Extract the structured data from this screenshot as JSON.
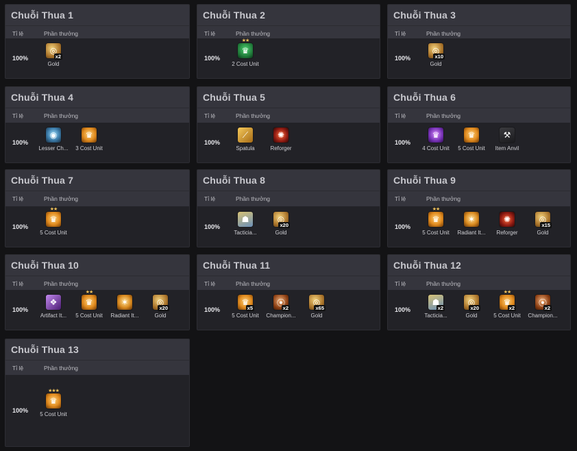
{
  "header": {
    "rate_label": "Tỉ lệ",
    "reward_label": "Phần thưởng"
  },
  "cards": [
    {
      "title": "Chuỗi Thua 1",
      "rate": "100%",
      "rewards": [
        {
          "label": "Gold",
          "icon": "gold-icon",
          "qty": "x2"
        }
      ]
    },
    {
      "title": "Chuỗi Thua 2",
      "rate": "100%",
      "rewards": [
        {
          "label": "2 Cost Unit",
          "icon": "unit-icon",
          "stars": "★★"
        }
      ]
    },
    {
      "title": "Chuỗi Thua 3",
      "rate": "100%",
      "rewards": [
        {
          "label": "Gold",
          "icon": "gold-icon",
          "qty": "x10"
        }
      ]
    },
    {
      "title": "Chuỗi Thua 4",
      "rate": "100%",
      "rewards": [
        {
          "label": "Lesser Ch...",
          "icon": "lesser-champion-orb-icon"
        },
        {
          "label": "3 Cost Unit",
          "icon": "unit-icon"
        }
      ]
    },
    {
      "title": "Chuỗi Thua 5",
      "rate": "100%",
      "rewards": [
        {
          "label": "Spatula",
          "icon": "spatula-icon"
        },
        {
          "label": "Reforger",
          "icon": "reforger-icon"
        }
      ]
    },
    {
      "title": "Chuỗi Thua 6",
      "rate": "100%",
      "rewards": [
        {
          "label": "4 Cost Unit",
          "icon": "unit-icon"
        },
        {
          "label": "5 Cost Unit",
          "icon": "unit-icon"
        },
        {
          "label": "Item Anvil",
          "icon": "anvil-icon"
        }
      ]
    },
    {
      "title": "Chuỗi Thua 7",
      "rate": "100%",
      "rewards": [
        {
          "label": "5 Cost Unit",
          "icon": "unit-icon",
          "stars": "★★"
        }
      ]
    },
    {
      "title": "Chuỗi Thua 8",
      "rate": "100%",
      "rewards": [
        {
          "label": "Tacticia...",
          "icon": "tactician-icon"
        },
        {
          "label": "Gold",
          "icon": "gold-icon",
          "qty": "x20"
        }
      ]
    },
    {
      "title": "Chuỗi Thua 9",
      "rate": "100%",
      "rewards": [
        {
          "label": "5 Cost Unit",
          "icon": "unit-icon",
          "stars": "★★"
        },
        {
          "label": "Radiant It...",
          "icon": "radiant-item-icon"
        },
        {
          "label": "Reforger",
          "icon": "reforger-icon"
        },
        {
          "label": "Gold",
          "icon": "gold-icon",
          "qty": "x15"
        }
      ]
    },
    {
      "title": "Chuỗi Thua 10",
      "rate": "100%",
      "rewards": [
        {
          "label": "Artifact It...",
          "icon": "artifact-item-icon"
        },
        {
          "label": "5 Cost Unit",
          "icon": "unit-icon",
          "stars": "★★"
        },
        {
          "label": "Radiant It...",
          "icon": "radiant-item-icon"
        },
        {
          "label": "Gold",
          "icon": "gold-icon",
          "qty": "x20"
        }
      ]
    },
    {
      "title": "Chuỗi Thua 11",
      "rate": "100%",
      "rewards": [
        {
          "label": "5 Cost Unit",
          "icon": "unit-icon",
          "qty": "x5"
        },
        {
          "label": "Champion...",
          "icon": "champion-icon",
          "qty": "x2"
        },
        {
          "label": "Gold",
          "icon": "gold-icon",
          "qty": "x65"
        }
      ]
    },
    {
      "title": "Chuỗi Thua 12",
      "rate": "100%",
      "rewards": [
        {
          "label": "Tacticia...",
          "icon": "tactician-icon",
          "qty": "x2"
        },
        {
          "label": "Gold",
          "icon": "gold-icon",
          "qty": "x20"
        },
        {
          "label": "5 Cost Unit",
          "icon": "unit-icon",
          "stars": "★★",
          "qty": "x2"
        },
        {
          "label": "Champion...",
          "icon": "champion-icon",
          "qty": "x2"
        }
      ]
    },
    {
      "title": "Chuỗi Thua 13",
      "rate": "100%",
      "rewards": [
        {
          "label": "5 Cost Unit",
          "icon": "unit-icon",
          "stars": "★★★"
        }
      ]
    }
  ]
}
